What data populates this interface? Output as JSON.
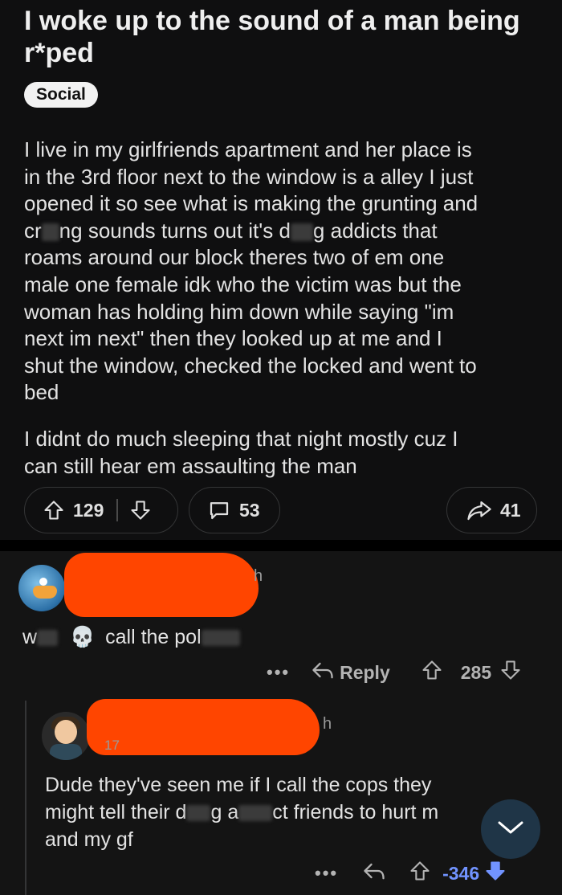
{
  "post": {
    "title": "I woke up to the sound of a man being r*ped",
    "flair": "Social",
    "body_p1_l1": "I live in my girlfriends apartment and her place is",
    "body_p1_l2": "in the 3rd floor next to the window is a alley I just",
    "body_p1_l3": "opened it so see what is making the grunting and",
    "body_p1_l4a": "cr",
    "body_p1_l4b": "ng sounds turns out it's d",
    "body_p1_l4c": "g addicts that",
    "body_p1_l5": "roams around our block theres two of em one",
    "body_p1_l6": "male one female idk who the victim was but the",
    "body_p1_l7": "woman has holding him down while saying \"im",
    "body_p1_l8": "next im next\" then they looked up at me and I",
    "body_p1_l9": "shut the window, checked the locked and went to",
    "body_p1_l10": "bed",
    "body_p2_l1": "I didnt do much sleeping that night mostly cuz I",
    "body_p2_l2": "can still hear em assaulting the man",
    "upvotes": "129",
    "comments": "53",
    "shares": "41"
  },
  "comment1": {
    "time": "h",
    "text_a": "w",
    "emoji": "💀",
    "text_b": "call the pol",
    "reply_label": "Reply",
    "score": "285"
  },
  "comment2": {
    "time": "h",
    "meta": "17",
    "line1": "Dude they've seen me if I call the cops they",
    "line2a": "might tell their d",
    "line2b": "g a",
    "line2c": "ct friends to hurt m",
    "line3": "and my gf",
    "score": "-346"
  },
  "icons": [
    "upvote-icon",
    "downvote-icon",
    "comment-icon",
    "share-icon",
    "reply-icon",
    "more-icon",
    "chevron-down-icon"
  ],
  "colors": {
    "accent_downvote": "#7193ff",
    "redaction": "#ff4500",
    "background": "#0e0e0e"
  }
}
